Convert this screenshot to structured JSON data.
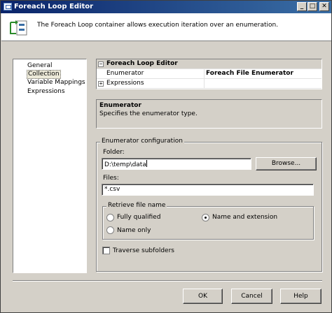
{
  "window": {
    "title": "Foreach Loop Editor"
  },
  "header": {
    "description": "The Foreach Loop container allows execution iteration over an enumeration."
  },
  "nav": {
    "items": [
      "General",
      "Collection",
      "Variable Mappings",
      "Expressions"
    ],
    "selected": "Collection"
  },
  "property_grid": {
    "category": "Foreach Loop Editor",
    "rows": [
      {
        "name": "Enumerator",
        "value": "Foreach File Enumerator"
      },
      {
        "name": "Expressions",
        "value": ""
      }
    ]
  },
  "description_pane": {
    "title": "Enumerator",
    "text": "Specifies the enumerator type."
  },
  "enumerator_config": {
    "title": "Enumerator configuration",
    "folder_label": "Folder:",
    "folder_value": "D:\\temp\\data",
    "browse_label": "Browse...",
    "files_label": "Files:",
    "files_value": "*.csv",
    "retrieve": {
      "title": "Retrieve file name",
      "options": [
        "Fully qualified",
        "Name and extension",
        "Name only"
      ],
      "selected": "Name and extension"
    },
    "traverse_label": "Traverse subfolders",
    "traverse_checked": false
  },
  "footer": {
    "ok_label": "OK",
    "cancel_label": "Cancel",
    "help_label": "Help"
  },
  "titlebar_buttons": {
    "minimize": "_",
    "maximize": "□",
    "close": "✕"
  }
}
